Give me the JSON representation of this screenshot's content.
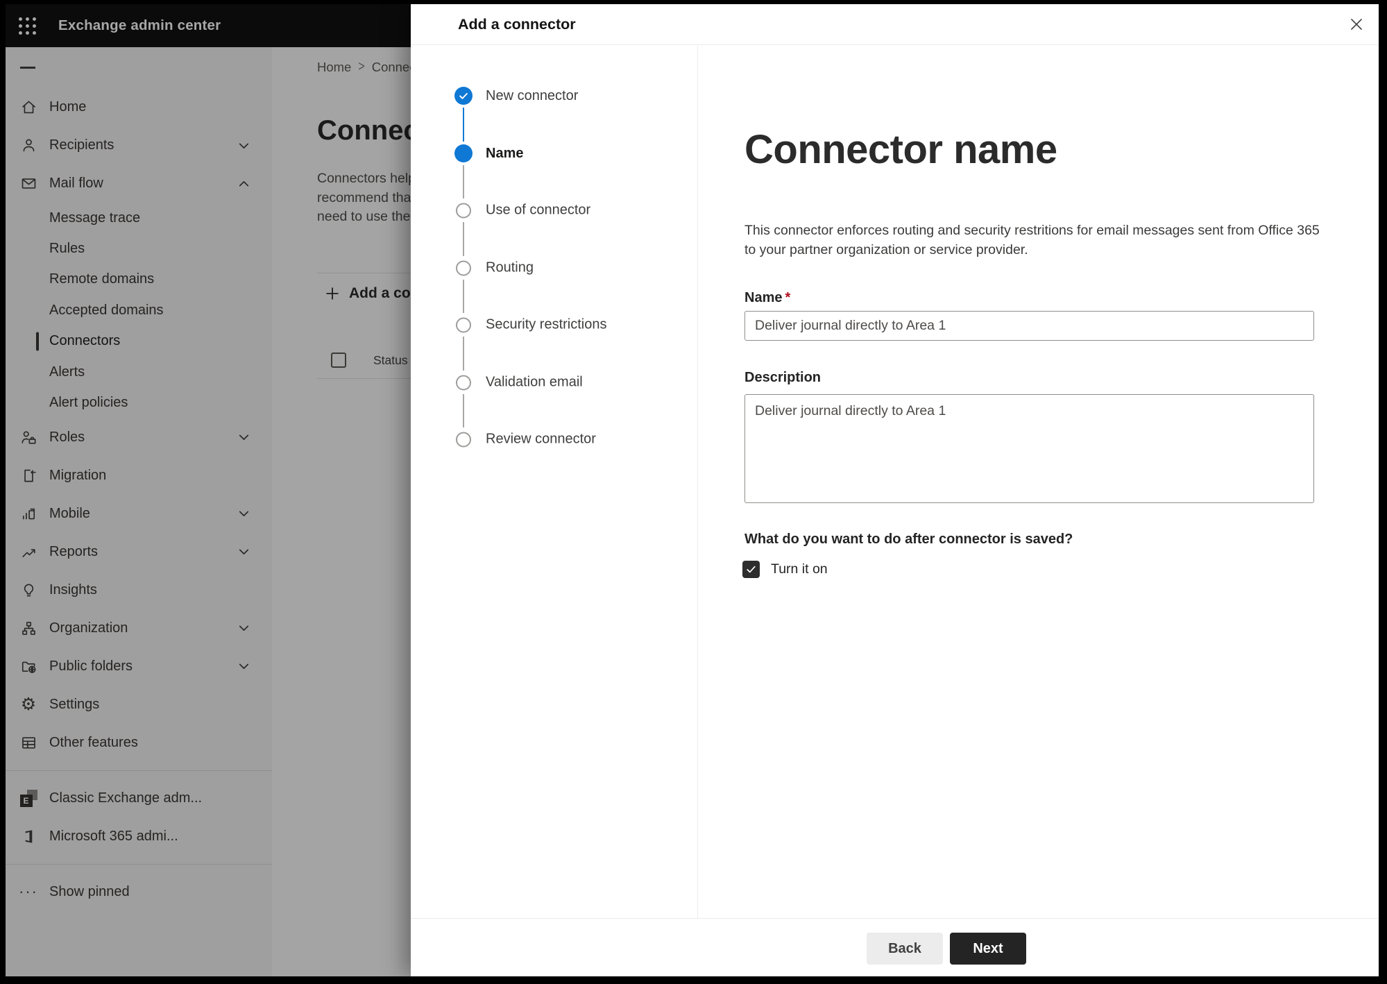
{
  "app_bar": {
    "title": "Exchange admin center",
    "waffle_icon": "waffle-icon"
  },
  "sidebar": {
    "hamburger_icon": "hamburger-icon",
    "items": [
      {
        "label": "Home",
        "icon": "home-icon",
        "type": "main"
      },
      {
        "label": "Recipients",
        "icon": "person-icon",
        "type": "main",
        "chevron": "down"
      },
      {
        "label": "Mail flow",
        "icon": "mail-icon",
        "type": "main",
        "chevron": "up"
      },
      {
        "label": "Message trace",
        "type": "sub"
      },
      {
        "label": "Rules",
        "type": "sub"
      },
      {
        "label": "Remote domains",
        "type": "sub"
      },
      {
        "label": "Accepted domains",
        "type": "sub"
      },
      {
        "label": "Connectors",
        "type": "sub",
        "selected": true
      },
      {
        "label": "Alerts",
        "type": "sub"
      },
      {
        "label": "Alert policies",
        "type": "sub"
      },
      {
        "label": "Roles",
        "icon": "roles-icon",
        "type": "main",
        "chevron": "down"
      },
      {
        "label": "Migration",
        "icon": "migration-icon",
        "type": "main"
      },
      {
        "label": "Mobile",
        "icon": "mobile-icon",
        "type": "main",
        "chevron": "down"
      },
      {
        "label": "Reports",
        "icon": "reports-icon",
        "type": "main",
        "chevron": "down"
      },
      {
        "label": "Insights",
        "icon": "insights-icon",
        "type": "main"
      },
      {
        "label": "Organization",
        "icon": "organization-icon",
        "type": "main",
        "chevron": "down"
      },
      {
        "label": "Public folders",
        "icon": "public-folders-icon",
        "type": "main",
        "chevron": "down"
      },
      {
        "label": "Settings",
        "icon": "settings-gear-icon",
        "type": "main"
      },
      {
        "label": "Other features",
        "icon": "other-features-icon",
        "type": "main"
      },
      {
        "divider": true
      },
      {
        "label": "Classic Exchange adm...",
        "icon": "exchange-logo-icon",
        "type": "main"
      },
      {
        "label": "Microsoft 365 admi...",
        "icon": "m365-logo-icon",
        "type": "main"
      },
      {
        "divider": true
      },
      {
        "label": "Show pinned",
        "icon": "ellipsis-icon",
        "type": "main"
      }
    ]
  },
  "page": {
    "breadcrumb": {
      "home": "Home",
      "separator": ">",
      "current": "Connectors"
    },
    "heading": "Connectors",
    "intro": "Connectors help\nrecommend that\nneed to use them",
    "add_button": {
      "label": "Add a connector",
      "icon": "add-icon"
    },
    "table": {
      "column_status": "Status"
    }
  },
  "dialog": {
    "title": "Add a connector",
    "close_icon": "close-icon",
    "steps": [
      {
        "label": "New connector",
        "state": "done"
      },
      {
        "label": "Name",
        "state": "current"
      },
      {
        "label": "Use of connector",
        "state": "upcoming"
      },
      {
        "label": "Routing",
        "state": "upcoming"
      },
      {
        "label": "Security restrictions",
        "state": "upcoming"
      },
      {
        "label": "Validation email",
        "state": "upcoming"
      },
      {
        "label": "Review connector",
        "state": "upcoming"
      }
    ],
    "content": {
      "title": "Connector name",
      "description": "This connector enforces routing and security restritions for email messages sent from Office 365\nto your partner organization or service provider.",
      "name_label": "Name",
      "required_marker": "*",
      "name_value": "Deliver journal directly to Area 1",
      "description_label": "Description",
      "description_value": "Deliver journal directly to Area 1",
      "question": "What do you want to do after connector is saved?",
      "checkbox_label": "Turn it on",
      "checkbox_checked": true
    },
    "footer": {
      "back_label": "Back",
      "next_label": "Next"
    }
  },
  "colors": {
    "accent_blue": "#0f78d4",
    "app_bar": "#0c0c0c",
    "primary_button": "#242424",
    "secondary_button": "#ececec",
    "required_red": "#b10e1c",
    "step_upcoming_gray": "#9e9c9a"
  }
}
